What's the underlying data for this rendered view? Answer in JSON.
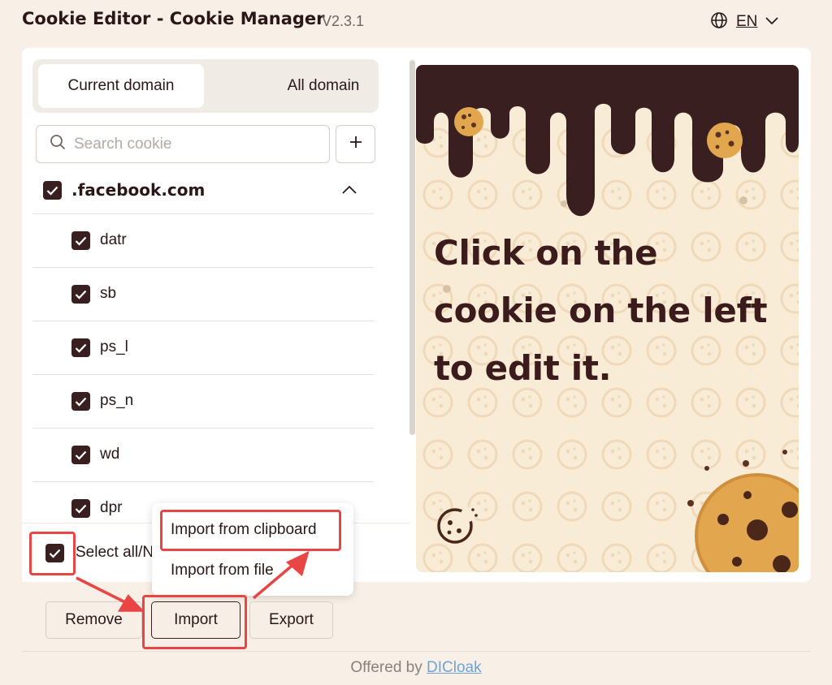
{
  "header": {
    "title": "Cookie Editor - Cookie Manager",
    "version": "V2.3.1",
    "language": "EN"
  },
  "tabs": [
    {
      "label": "Current domain",
      "active": true
    },
    {
      "label": "All domain",
      "active": false
    }
  ],
  "search": {
    "placeholder": "Search cookie",
    "value": ""
  },
  "add_button": "+",
  "domain": {
    "name": ".facebook.com",
    "checked": true,
    "expanded": true
  },
  "cookies": [
    {
      "name": "datr",
      "checked": true
    },
    {
      "name": "sb",
      "checked": true
    },
    {
      "name": "ps_l",
      "checked": true
    },
    {
      "name": "ps_n",
      "checked": true
    },
    {
      "name": "wd",
      "checked": true
    },
    {
      "name": "dpr",
      "checked": true
    }
  ],
  "select_all": {
    "label": "Select all/N",
    "checked": true
  },
  "illustration": {
    "message": "Click on the cookie on the left to edit it."
  },
  "import_menu": {
    "items": [
      "Import from clipboard",
      "Import from file"
    ]
  },
  "actions": {
    "remove": "Remove",
    "import": "Import",
    "export": "Export"
  },
  "footer": {
    "prefix": "Offered by",
    "link": "DICloak"
  },
  "colors": {
    "background": "#f8f0e6",
    "accent_dark": "#3a1f20",
    "highlight": "#e84545",
    "illustration_bg": "#f9ecd6",
    "link": "#6fa3d9"
  }
}
